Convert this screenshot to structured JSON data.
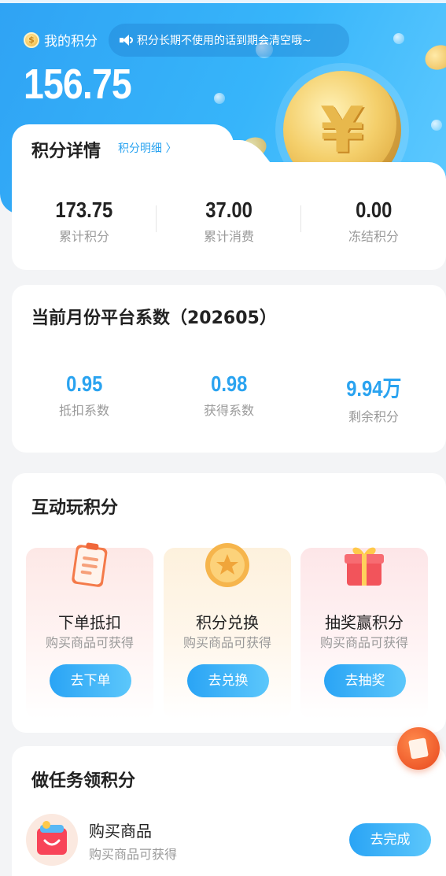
{
  "header": {
    "my_points_label": "我的积分",
    "notice": "积分长期不使用的话到期会清空哦~",
    "balance": "156.75",
    "coin_symbol": "¥"
  },
  "detail": {
    "title": "积分详情",
    "link": "积分明细 〉",
    "stats": [
      {
        "value": "173.75",
        "label": "累计积分"
      },
      {
        "value": "37.00",
        "label": "累计消费"
      },
      {
        "value": "0.00",
        "label": "冻结积分"
      }
    ]
  },
  "coefficient": {
    "title": "当前月份平台系数（202605）",
    "stats": [
      {
        "value": "0.95",
        "label": "抵扣系数"
      },
      {
        "value": "0.98",
        "label": "获得系数"
      },
      {
        "value": "9.94万",
        "label": "剩余积分"
      }
    ]
  },
  "play": {
    "title": "互动玩积分",
    "tiles": [
      {
        "icon": "clipboard-icon",
        "name": "下单抵扣",
        "sub": "购买商品可获得",
        "button": "去下单"
      },
      {
        "icon": "star-coin-icon",
        "name": "积分兑换",
        "sub": "购买商品可获得",
        "button": "去兑换"
      },
      {
        "icon": "gift-box-icon",
        "name": "抽奖赢积分",
        "sub": "购买商品可获得",
        "button": "去抽奖"
      }
    ]
  },
  "tasks": {
    "title": "做任务领积分",
    "items": [
      {
        "icon": "shopping-bag-icon",
        "name": "购买商品",
        "sub": "购买商品可获得",
        "button": "去完成"
      }
    ]
  },
  "colors": {
    "accent": "#2aa3f0",
    "header_gradient_start": "#2fa3f4",
    "header_gradient_end": "#5fcaff"
  }
}
